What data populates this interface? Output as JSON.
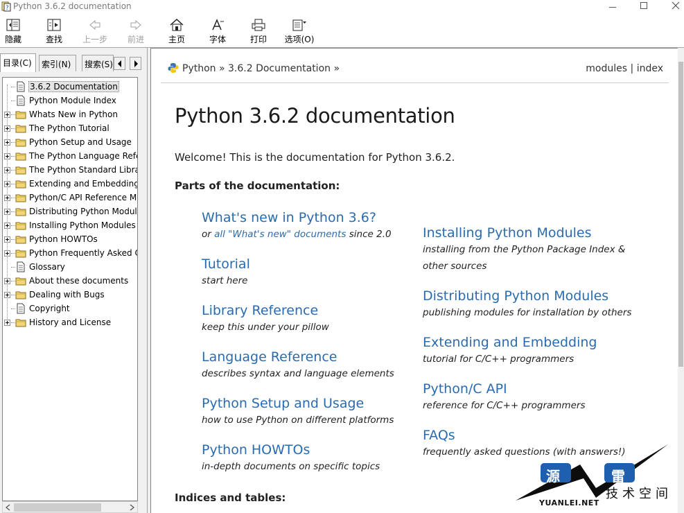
{
  "window": {
    "title": "Python 3.6.2 documentation"
  },
  "toolbar": {
    "buttons": [
      {
        "label": "隐藏",
        "icon": "hide-pane-icon",
        "enabled": true
      },
      {
        "label": "查找",
        "icon": "locate-icon",
        "enabled": true
      },
      {
        "label": "上一步",
        "icon": "back-arrow-icon",
        "enabled": false
      },
      {
        "label": "前进",
        "icon": "forward-arrow-icon",
        "enabled": false
      },
      {
        "label": "主页",
        "icon": "home-icon",
        "enabled": true
      },
      {
        "label": "字体",
        "icon": "font-icon",
        "enabled": true
      },
      {
        "label": "打印",
        "icon": "print-icon",
        "enabled": true
      },
      {
        "label": "选项(O)",
        "icon": "options-icon",
        "enabled": true
      }
    ]
  },
  "sidebar": {
    "tabs": [
      {
        "label": "目录(C)",
        "active": true
      },
      {
        "label": "索引(N)",
        "active": false
      },
      {
        "label": "搜索(S)",
        "active": false
      }
    ],
    "tree": [
      {
        "label": "3.6.2 Documentation",
        "type": "page",
        "expandable": false,
        "selected": true
      },
      {
        "label": "Python Module Index",
        "type": "page",
        "expandable": false,
        "selected": false
      },
      {
        "label": "Whats New in Python",
        "type": "folder",
        "expandable": true,
        "selected": false
      },
      {
        "label": "The Python Tutorial",
        "type": "folder",
        "expandable": true,
        "selected": false
      },
      {
        "label": "Python Setup and Usage",
        "type": "folder",
        "expandable": true,
        "selected": false
      },
      {
        "label": "The Python Language Refe",
        "type": "folder",
        "expandable": true,
        "selected": false
      },
      {
        "label": "The Python Standard Libra",
        "type": "folder",
        "expandable": true,
        "selected": false
      },
      {
        "label": "Extending and Embedding",
        "type": "folder",
        "expandable": true,
        "selected": false
      },
      {
        "label": "Python/C API Reference M",
        "type": "folder",
        "expandable": true,
        "selected": false
      },
      {
        "label": "Distributing Python Modul",
        "type": "folder",
        "expandable": true,
        "selected": false
      },
      {
        "label": "Installing Python Modules",
        "type": "folder",
        "expandable": true,
        "selected": false
      },
      {
        "label": "Python HOWTOs",
        "type": "folder",
        "expandable": true,
        "selected": false
      },
      {
        "label": "Python Frequently Asked C",
        "type": "folder",
        "expandable": true,
        "selected": false
      },
      {
        "label": "Glossary",
        "type": "page",
        "expandable": false,
        "selected": false
      },
      {
        "label": "About these documents",
        "type": "folder",
        "expandable": true,
        "selected": false
      },
      {
        "label": "Dealing with Bugs",
        "type": "folder",
        "expandable": true,
        "selected": false
      },
      {
        "label": "Copyright",
        "type": "page",
        "expandable": false,
        "selected": false
      },
      {
        "label": "History and License",
        "type": "folder",
        "expandable": true,
        "selected": false
      }
    ]
  },
  "related": {
    "crumb_python": "Python",
    "crumb_sep1": "»",
    "crumb_doc": "3.6.2 Documentation",
    "crumb_sep2": "»",
    "modules": "modules",
    "pipe": "|",
    "index": "index"
  },
  "main": {
    "title": "Python 3.6.2 documentation",
    "welcome": "Welcome! This is the documentation for Python 3.6.2.",
    "parts_heading": "Parts of the documentation:",
    "indices_heading": "Indices and tables:",
    "left_column": [
      {
        "title": "What's new in Python 3.6?",
        "desc_prefix": "or ",
        "desc_link": "all \"What's new\" documents",
        "desc_suffix": " since 2.0"
      },
      {
        "title": "Tutorial",
        "desc": "start here"
      },
      {
        "title": "Library Reference",
        "desc": "keep this under your pillow"
      },
      {
        "title": "Language Reference",
        "desc": "describes syntax and language elements"
      },
      {
        "title": "Python Setup and Usage",
        "desc": "how to use Python on different platforms"
      },
      {
        "title": "Python HOWTOs",
        "desc": "in-depth documents on specific topics"
      }
    ],
    "right_column": [
      {
        "title": "Installing Python Modules",
        "desc": "installing from the Python Package Index & other sources"
      },
      {
        "title": "Distributing Python Modules",
        "desc": "publishing modules for installation by others"
      },
      {
        "title": "Extending and Embedding",
        "desc": "tutorial for C/C++ programmers"
      },
      {
        "title": "Python/C API",
        "desc": "reference for C/C++ programmers"
      },
      {
        "title": "FAQs",
        "desc": "frequently asked questions (with answers!)"
      }
    ]
  },
  "watermark": {
    "char1": "源",
    "char2": "雷",
    "right_text": "技术空间",
    "url": "YUANLEI.NET"
  },
  "colors": {
    "link": "#2a6bb0",
    "watermark_blue": "#1f5fb0"
  }
}
